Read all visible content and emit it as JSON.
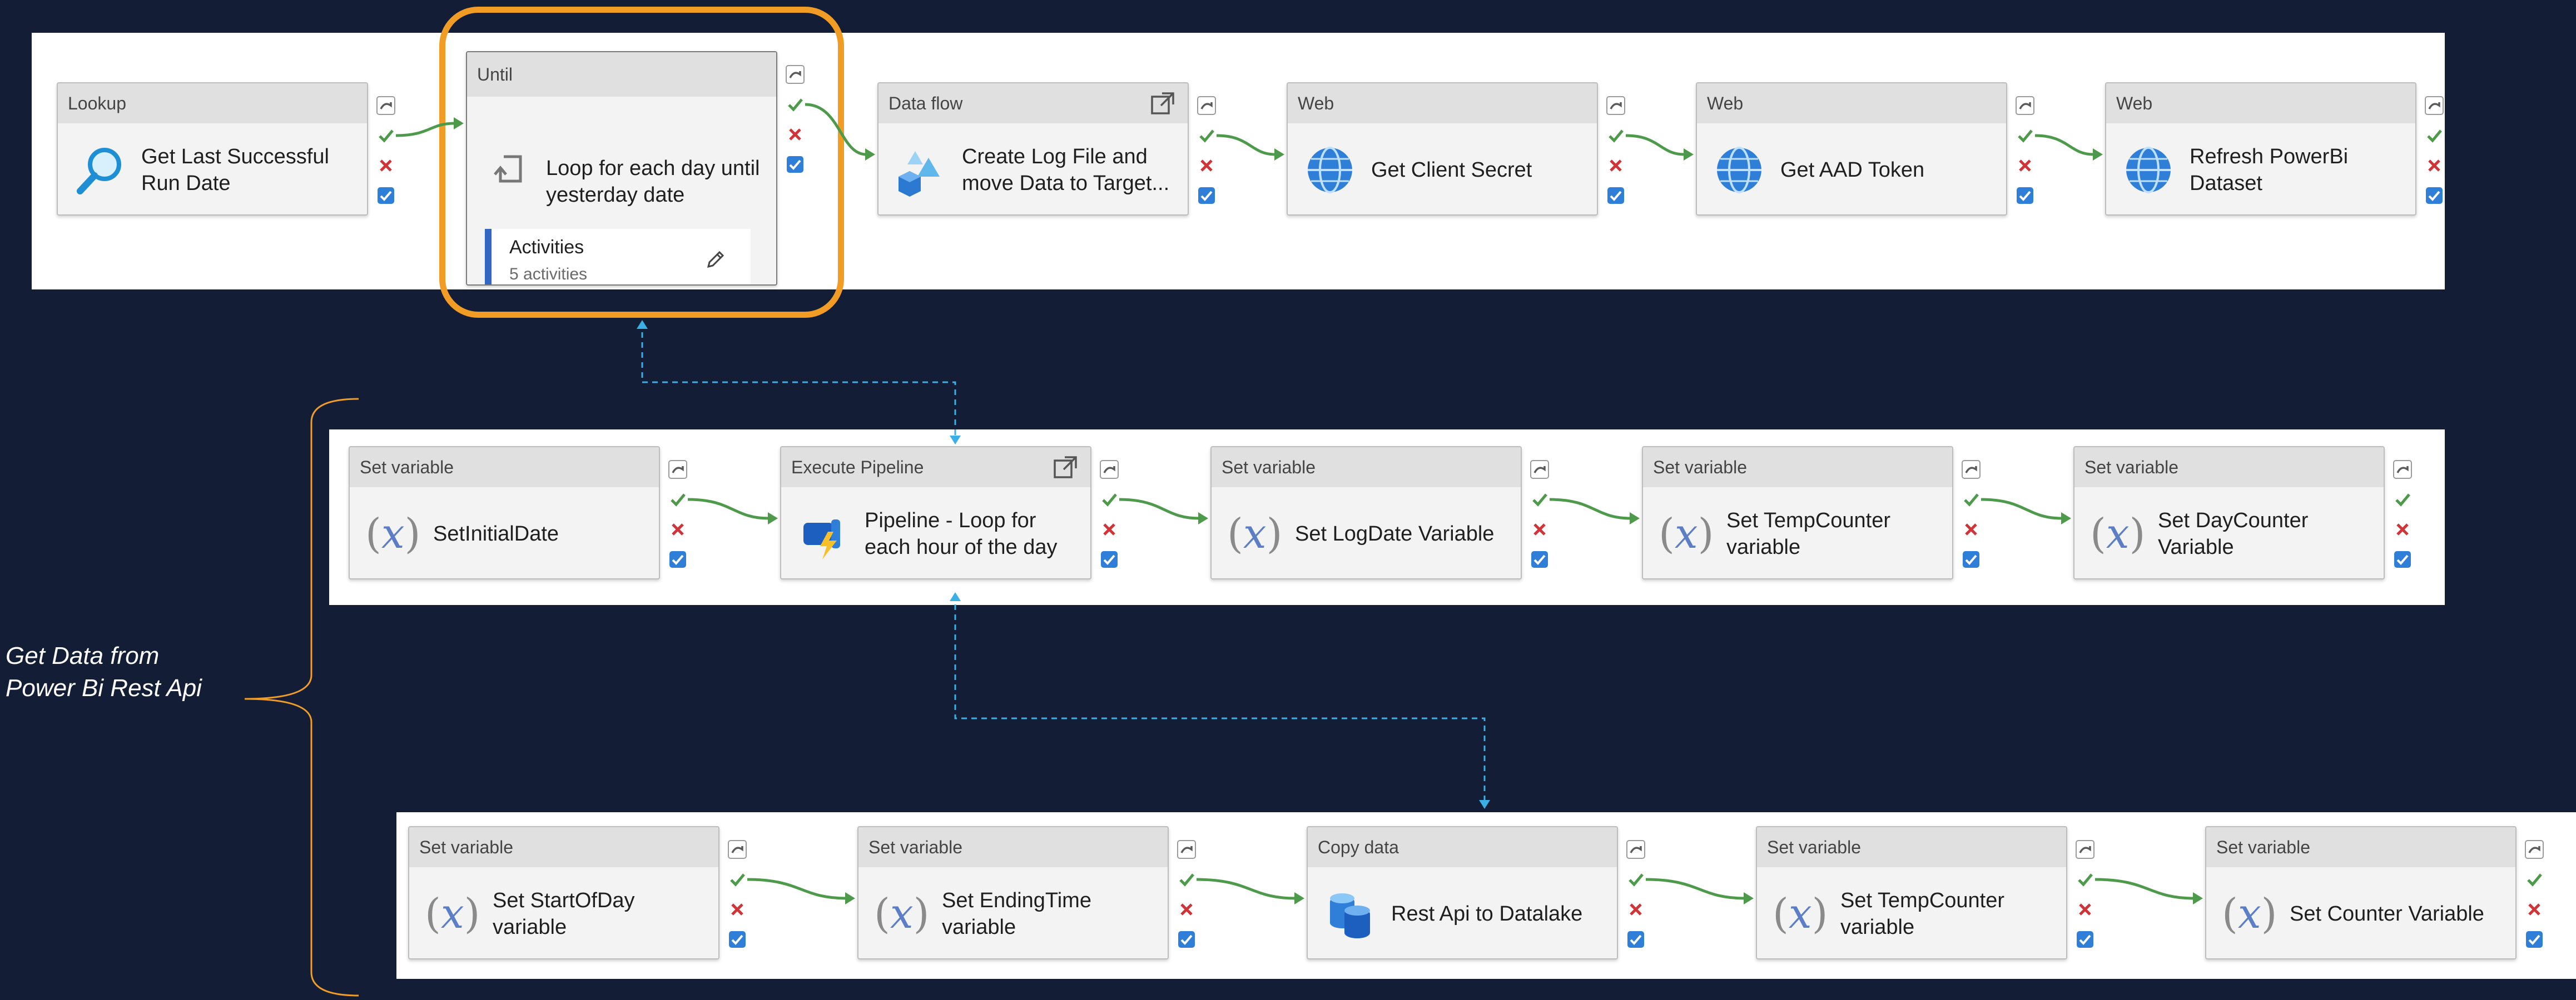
{
  "rows": [
    [
      {
        "type": "Lookup",
        "label": "Get Last Successful Run Date",
        "icon": "lookup-icon"
      },
      {
        "type": "Until",
        "label": "Loop for each day until yesterday date",
        "icon": "loop-icon",
        "activities_title": "Activities",
        "activities_count": "5 activities"
      },
      {
        "type": "Data flow",
        "label": "Create Log File and move Data to Target...",
        "icon": "dataflow-icon",
        "external": true
      },
      {
        "type": "Web",
        "label": "Get Client Secret",
        "icon": "globe-icon"
      },
      {
        "type": "Web",
        "label": "Get AAD Token",
        "icon": "globe-icon"
      },
      {
        "type": "Web",
        "label": "Refresh PowerBi Dataset",
        "icon": "globe-icon"
      }
    ],
    [
      {
        "type": "Set variable",
        "label": "SetInitialDate",
        "icon": "variable-icon"
      },
      {
        "type": "Execute Pipeline",
        "label": "Pipeline - Loop for each hour of the day",
        "icon": "pipeline-icon",
        "external": true
      },
      {
        "type": "Set variable",
        "label": "Set LogDate Variable",
        "icon": "variable-icon"
      },
      {
        "type": "Set variable",
        "label": "Set TempCounter variable",
        "icon": "variable-icon"
      },
      {
        "type": "Set variable",
        "label": "Set DayCounter Variable",
        "icon": "variable-icon"
      }
    ],
    [
      {
        "type": "Set variable",
        "label": "Set StartOfDay variable",
        "icon": "variable-icon"
      },
      {
        "type": "Set variable",
        "label": "Set EndingTime variable",
        "icon": "variable-icon"
      },
      {
        "type": "Copy data",
        "label": "Rest Api to Datalake",
        "icon": "database-icon"
      },
      {
        "type": "Set variable",
        "label": "Set TempCounter variable",
        "icon": "variable-icon"
      },
      {
        "type": "Set variable",
        "label": "Set Counter Variable",
        "icon": "variable-icon"
      }
    ]
  ],
  "annotation": {
    "line1": "Get Data from",
    "line2": "Power Bi Rest Api"
  },
  "colors": {
    "background": "#131d35",
    "highlight": "#f09c25",
    "success": "#4e9a4b",
    "failure": "#d13438",
    "completion": "#2f7fd8",
    "skip": "#5a5a5a",
    "connector": "#3ab0e6",
    "variable": "#5b7ec7",
    "activities_bar": "#2f67c3"
  }
}
